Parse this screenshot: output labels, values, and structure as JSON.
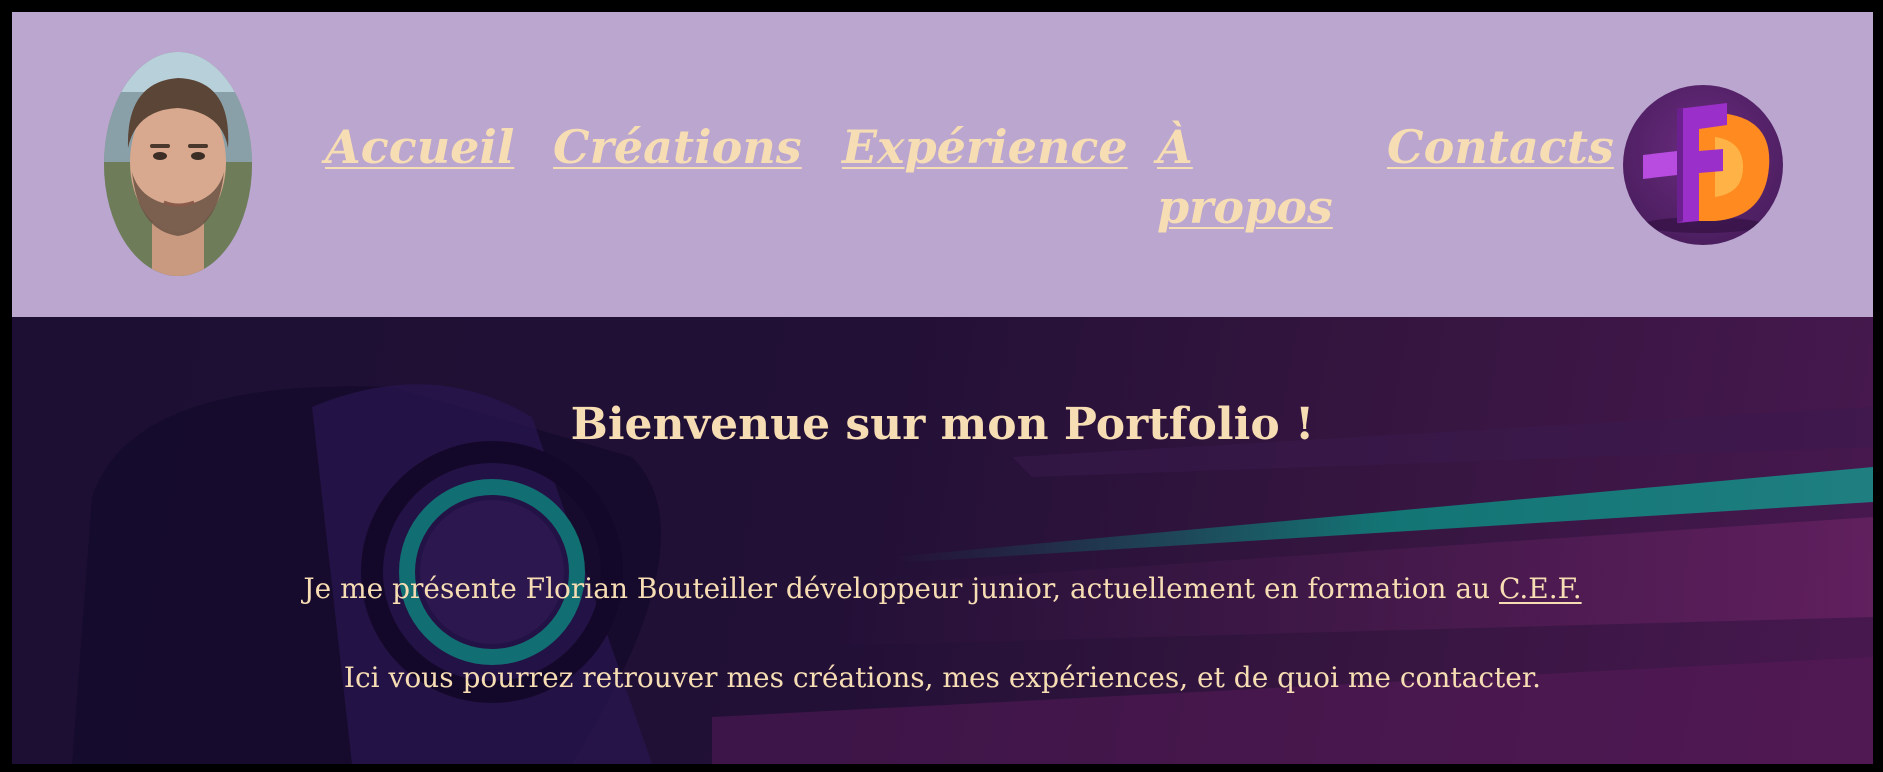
{
  "nav": {
    "items": [
      {
        "label": "Accueil"
      },
      {
        "label": "Créations"
      },
      {
        "label": "Expérience"
      },
      {
        "label_line1": "À",
        "label_line2": "propos"
      },
      {
        "label": "Contacts"
      }
    ]
  },
  "hero": {
    "title": "Bienvenue sur mon Portfolio !",
    "intro_text": "Je me présente Florian Bouteiller développeur junior, actuellement en formation au ",
    "intro_link": "C.E.F.",
    "second_line": "Ici vous pourrez retrouver mes créations, mes expériences, et de quoi me contacter."
  },
  "colors": {
    "header_bg": "#baa6cf",
    "nav_text": "#f7ddb3",
    "hero_bg": "#1c0f33",
    "logo_purple": "#9b2fc9",
    "logo_orange": "#ff8a1f"
  },
  "icons": {
    "avatar": "profile-photo",
    "logo": "fb-monogram-logo"
  }
}
